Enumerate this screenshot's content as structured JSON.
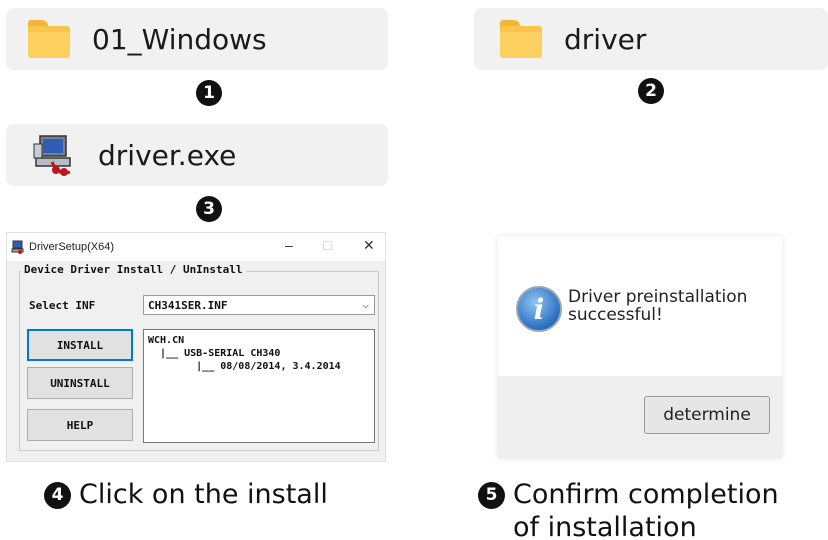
{
  "steps": [
    {
      "number": "1",
      "label": "01_Windows",
      "icon": "folder-icon"
    },
    {
      "number": "2",
      "label": "driver",
      "icon": "folder-icon"
    },
    {
      "number": "3",
      "label": "driver.exe",
      "icon": "installer-icon"
    },
    {
      "number": "4",
      "caption": "Click on the install"
    },
    {
      "number": "5",
      "caption_line1": "Confirm completion",
      "caption_line2": "of installation"
    }
  ],
  "setup_window": {
    "title": "DriverSetup(X64)",
    "controls": {
      "minimize": "–",
      "maximize": "□",
      "close": "✕"
    },
    "group_label": "Device Driver Install / UnInstall",
    "select_label": "Select INF",
    "select_value": "CH341SER.INF",
    "buttons": {
      "install": "INSTALL",
      "uninstall": "UNINSTALL",
      "help": "HELP"
    },
    "tree": {
      "line1": "WCH.CN",
      "line2": "  |__ USB-SERIAL CH340",
      "line3": "        |__ 08/08/2014, 3.4.2014"
    }
  },
  "success_dialog": {
    "message_line1": "Driver preinstallation",
    "message_line2": "successful!",
    "button_label": "determine",
    "icon": "info-icon"
  },
  "colors": {
    "pill_bg": "#f1f1f1",
    "folder": "#f9c64b",
    "focus_border": "#0078d7"
  }
}
